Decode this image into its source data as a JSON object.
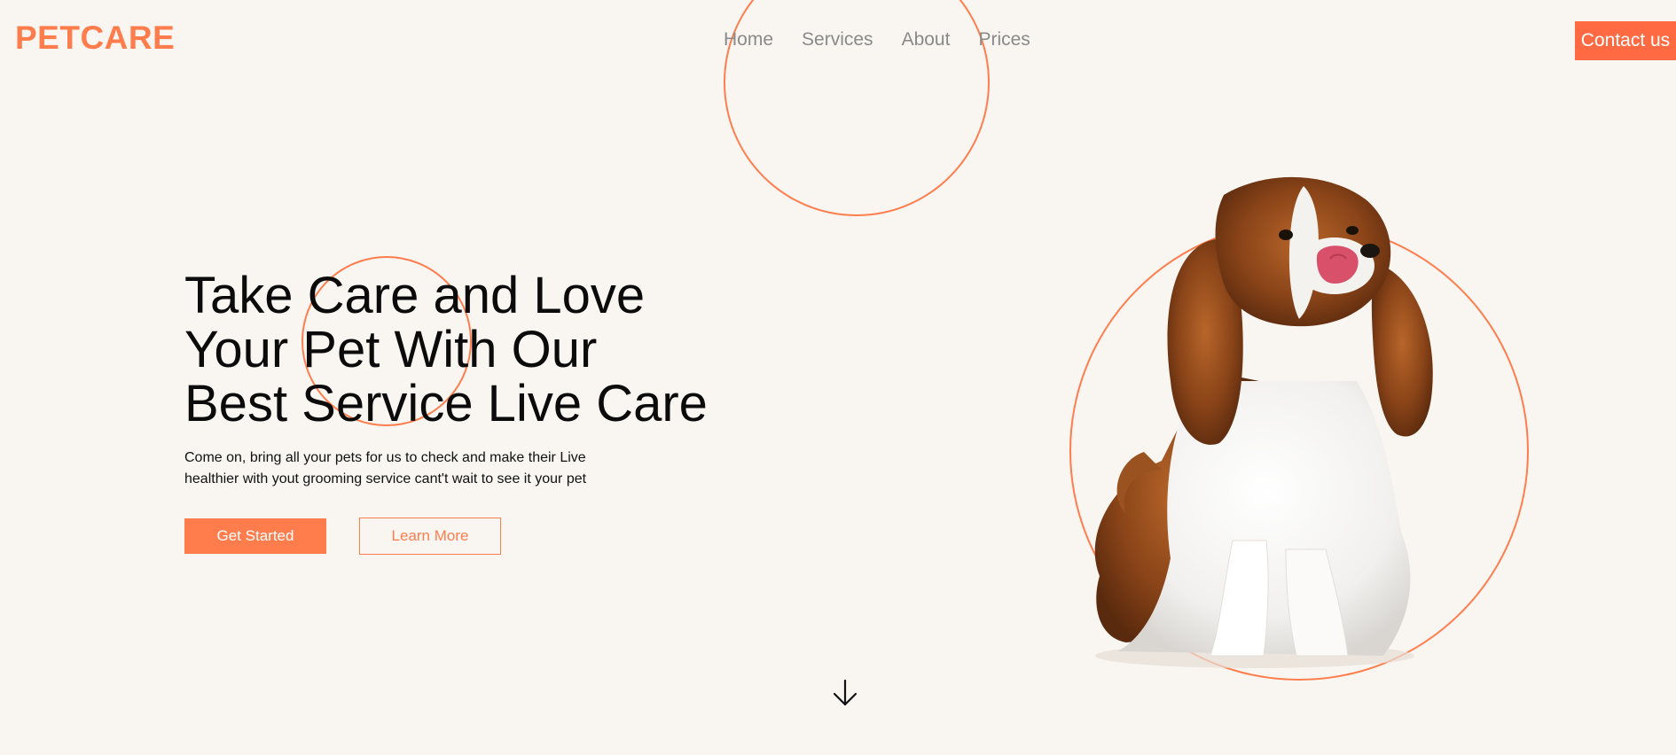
{
  "header": {
    "logo": "PETCARE",
    "nav": [
      "Home",
      "Services",
      "About",
      "Prices"
    ],
    "contact_label": "Contact us"
  },
  "hero": {
    "headline_lines": [
      "Take Care and Love",
      "Your Pet With Our",
      "Best Service Live Care"
    ],
    "subtext_lines": [
      "Come on, bring all your pets for us to check and make their Live",
      "healthier with yout grooming service cant't wait to see it your pet"
    ],
    "primary_label": "Get Started",
    "secondary_label": "Learn More"
  },
  "icons": {
    "scroll": "arrow-down-icon",
    "hero_image": "dog-image"
  },
  "colors": {
    "accent": "#ff7d4d",
    "contact_button": "#ff6a42",
    "background": "#f9f6f2",
    "nav_text": "#8a8a8a"
  }
}
